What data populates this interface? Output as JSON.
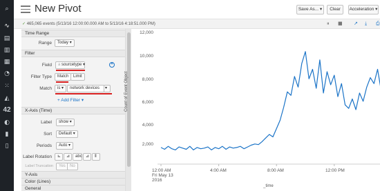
{
  "app": {
    "title": "New Pivot",
    "buttons": {
      "save_as": "Save As...",
      "clear": "Clear",
      "acceleration": "Acceleration"
    }
  },
  "sidebar_icons": [
    "search-icon",
    "pulse-icon",
    "datasets-icon",
    "bar-chart-icon",
    "table-icon",
    "pie-chart-icon",
    "scatter-icon",
    "area-chart-icon",
    "single-value-icon",
    "gauge-icon",
    "thermometer-icon",
    "filler-gauge-icon"
  ],
  "sidebar_number": "42",
  "status": {
    "check": "✓",
    "text": "465,065 events (5/13/16 12:00:00.000 AM to 5/13/16 4:18:51.000 PM)"
  },
  "panel": {
    "time_range": {
      "title": "Time Range",
      "range_label": "Range",
      "range_value": "Today"
    },
    "filter": {
      "title": "Filter",
      "field_label": "Field",
      "field_value": "sourcetype",
      "field_prefix": "a",
      "type_label": "Filter Type",
      "type_options": [
        "Match",
        "Limit"
      ],
      "match_label": "Match",
      "match_operator": "is",
      "match_value": "network devices",
      "add_filter": "+ Add Filter"
    },
    "xaxis": {
      "title": "X-Axis (Time)",
      "label_label": "Label",
      "label_value": "show",
      "sort_label": "Sort",
      "sort_value": "Default",
      "periods_label": "Periods",
      "periods_value": "Auto",
      "rotation_label": "Label Rotation",
      "rotation_options": [
        "⊾",
        "⊿",
        "abc",
        "⊿",
        "⦀"
      ],
      "truncation_label": "Label Truncation",
      "truncation_options": [
        "Yes",
        "No"
      ]
    },
    "yaxis_title": "Y-Axis",
    "color_title": "Color (Lines)",
    "general_title": "General"
  },
  "chart_data": {
    "type": "line",
    "ylabel": "Count of Event Object",
    "xlabel": "_time",
    "ylim": [
      0,
      12000
    ],
    "yticks": [
      "12,000",
      "10,000",
      "8,000",
      "6,000",
      "4,000",
      "2,000"
    ],
    "xticks": [
      {
        "lines": [
          "12:00 AM",
          "Fri May 13",
          "2016"
        ]
      },
      {
        "lines": [
          "4:00 AM"
        ]
      },
      {
        "lines": [
          "8:00 AM"
        ]
      },
      {
        "lines": [
          "12:00 PM"
        ]
      }
    ],
    "color": "#1a73c7",
    "series": [
      {
        "x_hours": [
          0,
          0.25,
          0.5,
          0.75,
          1,
          1.25,
          1.5,
          1.75,
          2,
          2.25,
          2.5,
          2.75,
          3,
          3.25,
          3.5,
          3.75,
          4,
          4.25,
          4.5,
          4.75,
          5,
          5.25,
          5.5,
          5.75,
          6,
          6.25,
          6.5,
          6.75,
          7,
          7.25,
          7.5,
          7.75,
          8,
          8.25,
          8.5,
          8.75,
          9,
          9.25,
          9.5,
          9.75,
          10,
          10.25,
          10.5,
          10.75,
          11,
          11.25,
          11.5,
          11.75,
          12,
          12.25,
          12.5,
          12.75,
          13,
          13.25,
          13.5,
          13.75,
          14,
          14.25,
          14.5,
          14.75,
          15,
          15.25,
          15.5,
          15.75,
          16,
          16.25
        ],
        "values": [
          2400,
          2250,
          2500,
          2300,
          2200,
          2450,
          2350,
          2250,
          2500,
          2200,
          2400,
          2300,
          2350,
          2450,
          2200,
          2400,
          2300,
          2500,
          2250,
          2450,
          2350,
          2400,
          2500,
          2300,
          2450,
          2600,
          2700,
          2650,
          2900,
          3200,
          3500,
          3300,
          4000,
          4700,
          5800,
          7100,
          6800,
          8400,
          7500,
          9500,
          10500,
          8200,
          9000,
          7400,
          9800,
          7000,
          8800,
          7700,
          8500,
          6700,
          7800,
          6000,
          5700,
          6500,
          5600,
          7000,
          6300,
          7500,
          8300,
          7800,
          9000,
          7200,
          8400,
          7600,
          8800,
          8200
        ]
      }
    ]
  }
}
